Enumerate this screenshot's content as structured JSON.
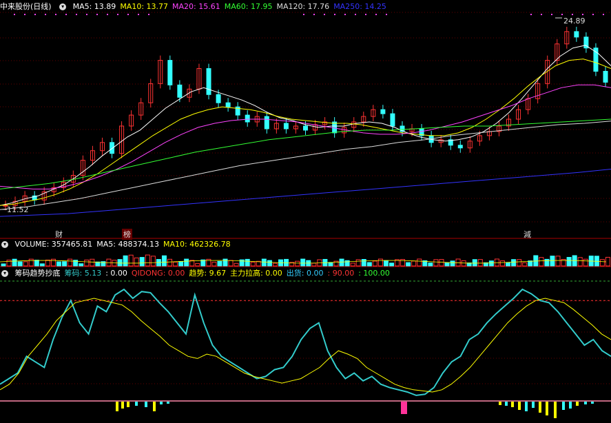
{
  "stock": {
    "name": "中来股份",
    "period": "(日线)"
  },
  "price_legend": [
    {
      "text": "MA5: 13.89",
      "color": "#ffffff"
    },
    {
      "text": "MA10: 13.77",
      "color": "#ffff00"
    },
    {
      "text": "MA20: 15.61",
      "color": "#ff44ff"
    },
    {
      "text": "MA60: 17.95",
      "color": "#33ff33"
    },
    {
      "text": "MA120: 17.76",
      "color": "#dddddd"
    },
    {
      "text": "MA250: 14.25",
      "color": "#3333ff"
    }
  ],
  "volume_legend": [
    {
      "text": "VOLUME: 357465.81",
      "color": "#ffffff"
    },
    {
      "text": "MA5: 488374.13",
      "color": "#ffffff"
    },
    {
      "text": "MA10: 462326.78",
      "color": "#ffff00"
    }
  ],
  "indicator_legend": [
    {
      "text": "筹码趋势抄底",
      "color": "#ffffff"
    },
    {
      "text": "筹码: 5.13",
      "color": "#33cccc"
    },
    {
      "text": ": 0.00",
      "color": "#ffffff"
    },
    {
      "text": "QIDONG: 0.00",
      "color": "#ff3333"
    },
    {
      "text": "趋势: 9.67",
      "color": "#ffff00"
    },
    {
      "text": "主力拉高: 0.00",
      "color": "#ffff00"
    },
    {
      "text": "出货: 0.00",
      "color": "#33ccff"
    },
    {
      "text": ": 90.00",
      "color": "#ff3333"
    },
    {
      "text": ": 100.00",
      "color": "#33ff33"
    }
  ],
  "annotations": {
    "high": "24.89",
    "low": "11.52",
    "marker1": "财",
    "marker2": "榜",
    "marker3": "減"
  },
  "chart_data": {
    "type": "line",
    "price_series": [
      11.6,
      11.9,
      12.3,
      12.0,
      12.6,
      12.9,
      13.3,
      13.8,
      14.9,
      15.6,
      16.2,
      15.4,
      17.4,
      18.2,
      19.1,
      20.5,
      22.2,
      20.4,
      19.5,
      20.1,
      21.6,
      19.7,
      19.1,
      18.8,
      18.2,
      17.7,
      18.1,
      17.2,
      17.6,
      17.2,
      17.4,
      17.1,
      17.5,
      17.7,
      16.9,
      17.3,
      17.7,
      18.1,
      18.6,
      18.3,
      17.4,
      17.0,
      17.2,
      16.7,
      16.2,
      16.4,
      16.0,
      15.8,
      16.3,
      16.7,
      17.0,
      17.4,
      17.9,
      18.6,
      19.4,
      20.5,
      22.2,
      23.4,
      24.3,
      23.9,
      23.1,
      21.4,
      20.6
    ],
    "ma_series": [
      {
        "name": "MA5",
        "values": [
          11.6,
          11.8,
          12.1,
          12.3,
          12.7,
          13.1,
          13.7,
          14.4,
          15.2,
          15.9,
          16.6,
          17.1,
          17.9,
          18.7,
          19.3,
          19.9,
          20.2,
          19.9,
          19.6,
          19.3,
          18.9,
          18.4,
          18.0,
          17.8,
          17.5,
          17.3,
          17.4,
          17.4,
          17.6,
          17.7,
          17.6,
          17.3,
          16.9,
          16.6,
          16.4,
          16.3,
          16.4,
          16.6,
          17.0,
          17.6,
          18.4,
          19.4,
          20.5,
          21.6,
          22.5,
          23.1,
          23.3,
          22.7,
          21.8
        ]
      },
      {
        "name": "MA10",
        "values": [
          11.6,
          11.7,
          11.9,
          12.1,
          12.4,
          12.8,
          13.3,
          13.9,
          14.6,
          15.3,
          16.0,
          16.7,
          17.3,
          17.9,
          18.3,
          18.6,
          18.8,
          18.7,
          18.6,
          18.4,
          18.1,
          17.9,
          17.8,
          17.7,
          17.6,
          17.6,
          17.5,
          17.3,
          17.1,
          16.9,
          16.8,
          16.7,
          16.7,
          16.9,
          17.3,
          17.9,
          18.6,
          19.4,
          20.3,
          21.1,
          21.8,
          22.2,
          22.3,
          22.0,
          21.6
        ]
      },
      {
        "name": "MA20",
        "values": [
          13.0,
          12.9,
          12.8,
          12.8,
          13.0,
          13.3,
          13.7,
          14.2,
          14.8,
          15.5,
          16.2,
          16.8,
          17.3,
          17.6,
          17.8,
          17.9,
          17.9,
          17.8,
          17.7,
          17.5,
          17.3,
          17.1,
          16.9,
          16.8,
          16.8,
          16.9,
          17.1,
          17.4,
          17.7,
          18.1,
          18.5,
          18.9,
          19.4,
          19.8,
          20.2,
          20.4,
          20.4,
          20.2
        ]
      },
      {
        "name": "MA60",
        "values": [
          12.8,
          13.0,
          13.2,
          13.5,
          13.9,
          14.3,
          14.7,
          15.1,
          15.5,
          15.8,
          16.1,
          16.4,
          16.6,
          16.8,
          17.0,
          17.1,
          17.1,
          17.2,
          17.3,
          17.4,
          17.4,
          17.5,
          17.6,
          17.7,
          17.8,
          17.9
        ]
      },
      {
        "name": "MA120",
        "values": [
          11.3,
          11.5,
          11.8,
          12.1,
          12.5,
          12.9,
          13.3,
          13.7,
          14.1,
          14.5,
          14.8,
          15.1,
          15.4,
          15.7,
          15.9,
          16.2,
          16.4,
          16.7,
          16.9,
          17.1,
          17.3,
          17.5,
          17.6,
          17.76
        ]
      },
      {
        "name": "MA250",
        "values": [
          10.8,
          10.9,
          11.0,
          11.2,
          11.4,
          11.6,
          11.8,
          12.0,
          12.2,
          12.4,
          12.6,
          12.8,
          13.0,
          13.2,
          13.4,
          13.6,
          13.8,
          14.0,
          14.25
        ]
      }
    ],
    "indicator": {
      "series": [
        {
          "name": "筹码",
          "values": [
            15,
            20,
            25,
            40,
            35,
            30,
            55,
            75,
            90,
            70,
            60,
            85,
            80,
            95,
            100,
            92,
            98,
            97,
            88,
            80,
            70,
            60,
            95,
            70,
            50,
            40,
            35,
            30,
            25,
            20,
            22,
            28,
            30,
            40,
            55,
            65,
            70,
            45,
            30,
            20,
            25,
            18,
            22,
            15,
            12,
            10,
            8,
            5,
            6,
            12,
            25,
            35,
            40,
            55,
            60,
            70,
            78,
            85,
            92,
            100,
            96,
            90,
            88,
            80,
            70,
            60,
            50,
            55,
            45,
            40
          ]
        },
        {
          "name": "趋势",
          "values": [
            10,
            15,
            25,
            40,
            50,
            60,
            72,
            80,
            88,
            90,
            92,
            90,
            88,
            86,
            80,
            72,
            65,
            58,
            50,
            45,
            40,
            38,
            42,
            40,
            35,
            30,
            25,
            22,
            20,
            18,
            16,
            18,
            20,
            25,
            30,
            38,
            45,
            42,
            38,
            30,
            25,
            20,
            15,
            12,
            10,
            9,
            8,
            10,
            15,
            22,
            30,
            40,
            50,
            60,
            70,
            78,
            85,
            90,
            92,
            90,
            88,
            82,
            75,
            68,
            60,
            55
          ]
        }
      ],
      "reference_levels": [
        90,
        100
      ],
      "ylim": [
        0,
        100
      ]
    }
  }
}
